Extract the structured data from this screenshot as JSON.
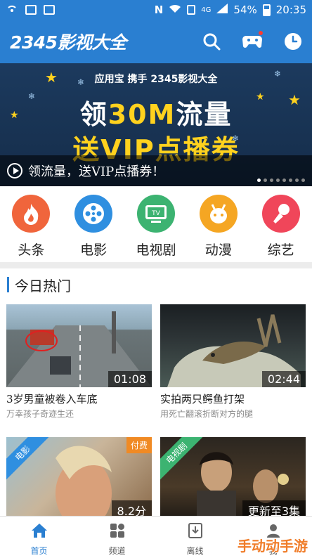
{
  "status_bar": {
    "battery": "54%",
    "time": "20:35",
    "network": "4G",
    "notification": "N"
  },
  "header": {
    "logo": "2345影视大全"
  },
  "banner": {
    "brand_line": "应用宝  携手  2345影视大全",
    "line1_prefix": "领",
    "line1_highlight": "30M",
    "line1_suffix": "流量",
    "line2": "送VIP点播券",
    "caption": "领流量，送VIP点播券！",
    "dot_count": 8,
    "active_dot": 0
  },
  "categories": [
    {
      "label": "头条",
      "color": "#f0653c",
      "icon": "flame-icon"
    },
    {
      "label": "电影",
      "color": "#2f8fe0",
      "icon": "film-reel-icon"
    },
    {
      "label": "电视剧",
      "color": "#3cb371",
      "icon": "tv-icon"
    },
    {
      "label": "动漫",
      "color": "#f5a623",
      "icon": "anime-face-icon"
    },
    {
      "label": "综艺",
      "color": "#f0465a",
      "icon": "microphone-icon"
    }
  ],
  "hot": {
    "title": "今日热门",
    "cards": [
      {
        "title": "3岁男童被卷入车底",
        "subtitle": "万幸孩子奇迹生还",
        "duration": "01:08"
      },
      {
        "title": "实拍两只鳄鱼打架",
        "subtitle": "用死亡翻滚折断对方的腿",
        "duration": "02:44"
      },
      {
        "ribbon": "电影",
        "tag": "付费",
        "duration": "8.2分"
      },
      {
        "ribbon": "电视剧",
        "duration": "更新至3集"
      }
    ]
  },
  "bottom_nav": [
    {
      "label": "首页",
      "icon": "home-icon",
      "active": true
    },
    {
      "label": "频道",
      "icon": "grid-icon",
      "active": false
    },
    {
      "label": "离线",
      "icon": "download-icon",
      "active": false
    },
    {
      "label": "我",
      "icon": "user-icon",
      "active": false
    }
  ],
  "watermark": "手动动手游",
  "colors": {
    "primary": "#2a7fd1",
    "banner_yellow": "#ffd21e"
  }
}
